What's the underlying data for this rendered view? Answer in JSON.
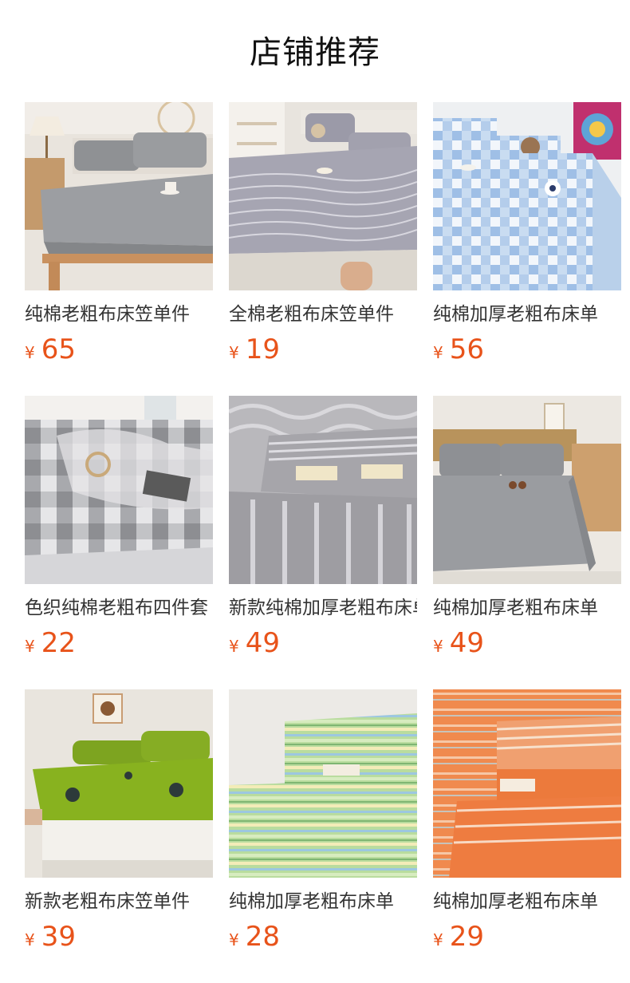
{
  "header": {
    "title": "店铺推荐"
  },
  "currency": "¥",
  "products": [
    {
      "name": "纯棉老粗布床笠单件",
      "price": "65",
      "image": "grey-fitted-sheet-bedroom"
    },
    {
      "name": "全棉老粗布床笠单件",
      "price": "19",
      "image": "grey-white-striped-fitted-sheet"
    },
    {
      "name": "纯棉加厚老粗布床单",
      "price": "56",
      "image": "blue-white-plaid-sheet"
    },
    {
      "name": "色织纯棉老粗布四件套",
      "price": "22",
      "image": "grey-check-bedding-set"
    },
    {
      "name": "新款纯棉加厚老粗布床单",
      "price": "49",
      "image": "grey-striped-folded-cloth"
    },
    {
      "name": "纯棉加厚老粗布床单",
      "price": "49",
      "image": "grey-flat-sheet-bedroom"
    },
    {
      "name": "新款老粗布床笠单件",
      "price": "39",
      "image": "green-printed-fitted-sheet"
    },
    {
      "name": "纯棉加厚老粗布床单",
      "price": "28",
      "image": "green-yellow-striped-folded-cloth"
    },
    {
      "name": "纯棉加厚老粗布床单",
      "price": "29",
      "image": "orange-striped-folded-cloth"
    }
  ]
}
